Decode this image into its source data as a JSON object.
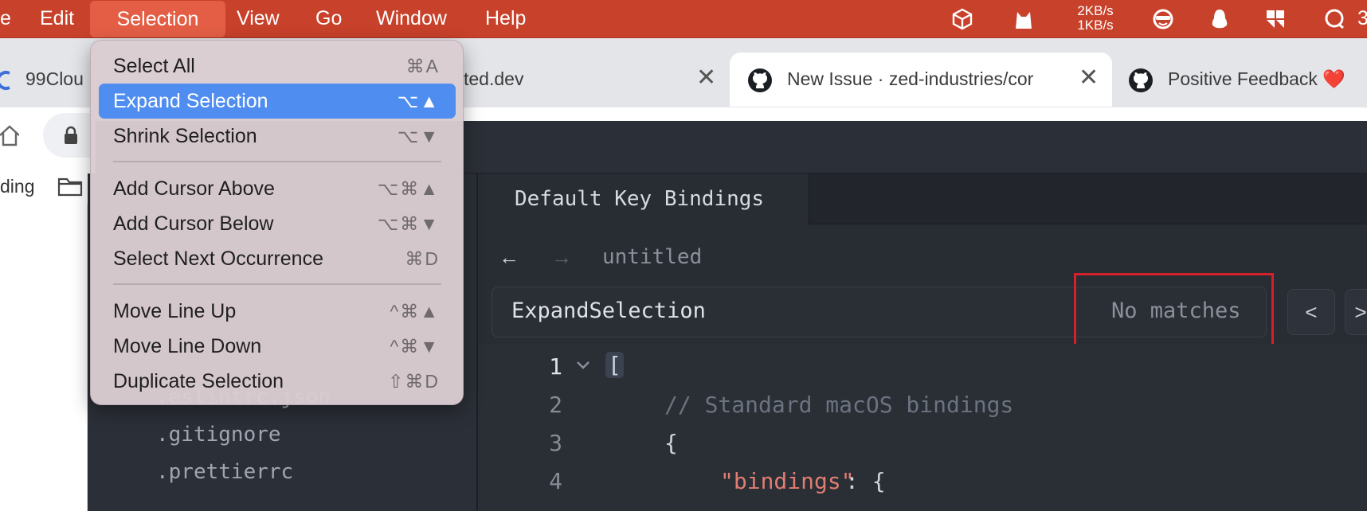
{
  "menubar": {
    "items": [
      "e",
      "Edit",
      "Selection",
      "View",
      "Go",
      "Window",
      "Help"
    ],
    "net_up": "2KB/s",
    "net_down": "1KB/s",
    "tray_cut": "3"
  },
  "tray_icons": [
    "box-icon",
    "cat-icon",
    "mascot-icon",
    "penguin-icon",
    "app-grid-icon",
    "chat-icon"
  ],
  "browser": {
    "tabs": [
      {
        "label": "99Clou",
        "close": ""
      },
      {
        "label": "ted.dev",
        "close": "✕"
      },
      {
        "label": "New Issue · zed-industries/cor",
        "close": "✕"
      },
      {
        "label": "Positive Feedback ❤️",
        "close": ""
      }
    ],
    "bookmark_label": "ding"
  },
  "menu": {
    "items": [
      {
        "label": "Select All",
        "shortcut": "⌘A"
      },
      {
        "label": "Expand Selection",
        "shortcut": "⌥▲"
      },
      {
        "label": "Shrink Selection",
        "shortcut": "⌥▼"
      },
      {
        "label": "Add Cursor Above",
        "shortcut": "⌥⌘▲"
      },
      {
        "label": "Add Cursor Below",
        "shortcut": "⌥⌘▼"
      },
      {
        "label": "Select Next Occurrence",
        "shortcut": "⌘D"
      },
      {
        "label": "Move Line Up",
        "shortcut": "^⌘▲"
      },
      {
        "label": "Move Line Down",
        "shortcut": "^⌘▼"
      },
      {
        "label": "Duplicate Selection",
        "shortcut": "⇧⌘D"
      }
    ]
  },
  "editor": {
    "tab_title": "Default Key Bindings",
    "back": "←",
    "forward": "→",
    "file_title": "untitled",
    "search_query": "ExpandSelection",
    "search_status": "No matches",
    "prev": "<",
    "next": ">",
    "lines": [
      "1",
      "2",
      "3",
      "4"
    ],
    "code": {
      "line1": "[",
      "line2": "// Standard macOS bindings",
      "line3": "{",
      "line4_key": "\"bindings\"",
      "line4_rest": ": {"
    },
    "files": [
      ".eslintrc.json",
      ".gitignore",
      ".prettierrc"
    ]
  },
  "colors": {
    "menubar": "#c8412a",
    "highlight": "#4f8ef0",
    "annotation": "#d3202a"
  }
}
